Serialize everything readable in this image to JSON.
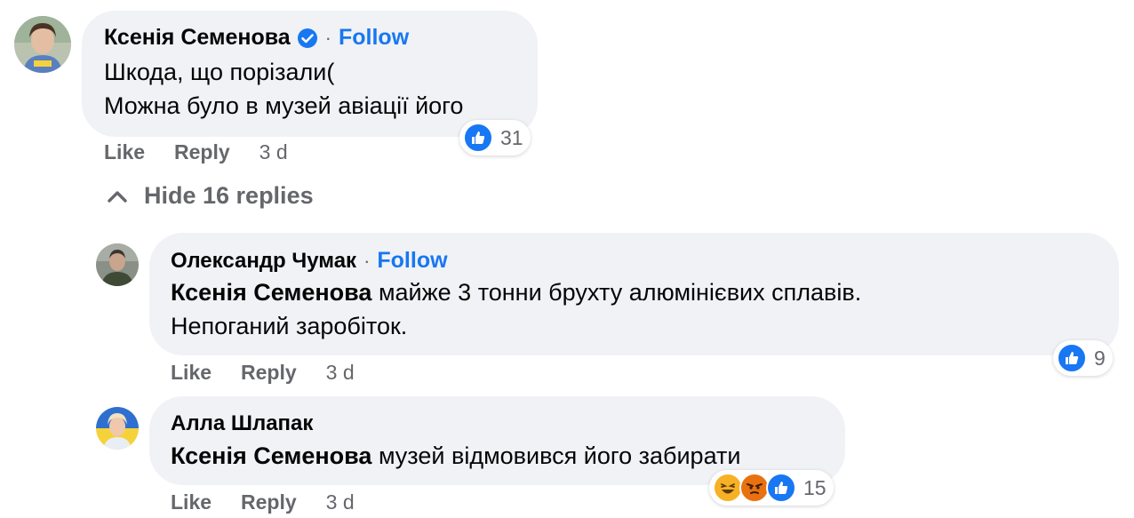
{
  "comment": {
    "author": "Ксенія Семенова",
    "verified": true,
    "follow_label": "Follow",
    "separator": "·",
    "lines": [
      "Шкода, що порізали(",
      "Можна було в музей авіації його"
    ],
    "actions": {
      "like": "Like",
      "reply": "Reply",
      "time": "3 d"
    },
    "reactions": {
      "types": [
        "like-icon"
      ],
      "count": "31"
    }
  },
  "hide_replies": {
    "label": "Hide 16 replies",
    "icon": "chevron-up-icon"
  },
  "replies": [
    {
      "author": "Олександр Чумак",
      "separator": "·",
      "follow_label": "Follow",
      "mention": "Ксенія Семенова",
      "line1": " майже 3 тонни брухту алюмінієвих сплавів.",
      "line2": "Непоганий заробіток.",
      "actions": {
        "like": "Like",
        "reply": "Reply",
        "time": "3 d"
      },
      "reactions": {
        "types": [
          "like-icon"
        ],
        "count": "9"
      }
    },
    {
      "author": "Алла Шлапак",
      "mention": "Ксенія Семенова",
      "line1": " музей відмовився його забирати",
      "actions": {
        "like": "Like",
        "reply": "Reply",
        "time": "3 d"
      },
      "reactions": {
        "types": [
          "haha-icon",
          "angry-icon",
          "like-icon"
        ],
        "count": "15"
      }
    }
  ],
  "colors": {
    "bubble": "#f0f2f5",
    "link": "#1877f2",
    "secondary_text": "#65676b",
    "like_blue": "#1877f2"
  }
}
